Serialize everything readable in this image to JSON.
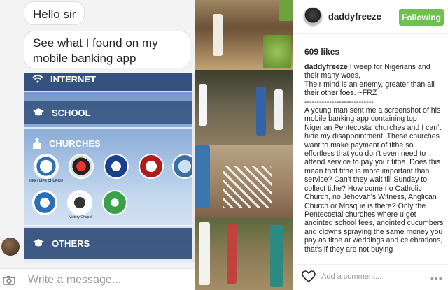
{
  "chat": {
    "bubble1": "Hello sir",
    "bubble2": "See what I found on my mobile banking app",
    "message_placeholder": "Write a message..."
  },
  "banking_app": {
    "rows": [
      "INTERNET",
      "SCHOOL",
      "CHURCHES",
      "OTHERS"
    ],
    "logo_labels": [
      "HIGH LIFE CHURCH",
      "Victory Chapel"
    ]
  },
  "post": {
    "username": "daddyfreeze",
    "follow_label": "Following",
    "likes": "609 likes",
    "caption_user": "daddyfreeze",
    "caption_text": " I weep for Nigerians and their many woes,\nTheir mind is an enemy, greater than all their other foes. ~FRZ\n----------------------------\nA young man sent me a screenshot of his mobile banking app containing top Nigerian Pentecostal churches and I can't hide my disappointment. These churches want to make payment of tithe so effortless that you don't even need to attend service to pay your tithe. Does this mean that tithe is more important than service? Can't they wait till Sunday to collect tithe? How come no Catholic Church, no Jehovah's Witness, Anglican Church or Mosque is there? Only the Pentecostal churches where u get anointed school fees, anointed cucumbers and clowns spraying the same money you pay as tithe at weddings and celebrations, that's if they are not buying",
    "comment_placeholder": "Add a comment...",
    "more_label": "•••"
  },
  "colors": {
    "follow_green": "#70c050",
    "banking_blue": "#304c78"
  },
  "icons": [
    "wifi-icon",
    "graduation-cap-icon",
    "church-icon",
    "camera-icon",
    "heart-icon",
    "more-icon"
  ]
}
